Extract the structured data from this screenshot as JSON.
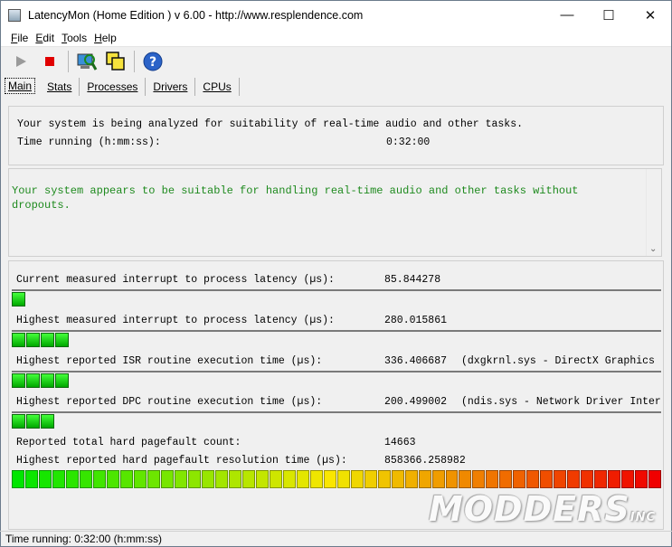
{
  "window": {
    "title": "LatencyMon  (Home Edition )  v 6.00 - http://www.resplendence.com",
    "minimize": "—",
    "maximize": "☐",
    "close": "✕"
  },
  "menu": [
    "File",
    "Edit",
    "Tools",
    "Help"
  ],
  "toolbar": {
    "buttons": [
      "play-icon",
      "stop-icon",
      "search-computer-icon",
      "windows-icon",
      "help-icon"
    ]
  },
  "tabs": [
    "Main",
    "Stats",
    "Processes",
    "Drivers",
    "CPUs"
  ],
  "status_panel": {
    "line1": "Your system is being analyzed for suitability of real-time audio and other tasks.",
    "time_label": "Time running (h:mm:ss):",
    "time_value": "0:32:00"
  },
  "verdict": {
    "text": "Your system appears to be suitable for handling real-time audio and other tasks without dropouts.",
    "color": "#1e8a1e"
  },
  "metrics": [
    {
      "label": "Current measured interrupt to process latency (µs):",
      "value": "85.844278",
      "extra": "",
      "segments": 1
    },
    {
      "label": "Highest measured interrupt to process latency (µs):",
      "value": "280.015861",
      "extra": "",
      "segments": 4
    },
    {
      "label": "Highest reported ISR routine execution time (µs):",
      "value": "336.406687",
      "extra": "(dxgkrnl.sys - DirectX Graphics",
      "segments": 4
    },
    {
      "label": "Highest reported DPC routine execution time (µs):",
      "value": "200.499002",
      "extra": "(ndis.sys - Network Driver Inter",
      "segments": 3
    }
  ],
  "pagefault": {
    "count_label": "Reported total hard pagefault count:",
    "count_value": "14663",
    "resolution_label": "Highest reported hard pagefault resolution time (µs):",
    "resolution_value": "858366.258982",
    "segments": 48
  },
  "statusbar": "Time running: 0:32:00  (h:mm:ss)",
  "watermark": {
    "main": "MODDERS",
    "sub": "INC"
  }
}
